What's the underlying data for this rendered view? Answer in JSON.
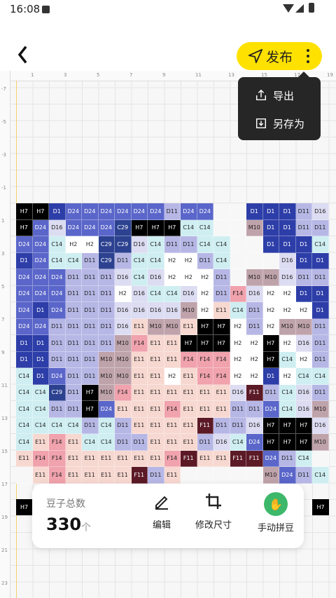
{
  "status": {
    "time": "16:08"
  },
  "header": {
    "publish_label": "发布"
  },
  "menu": {
    "export_label": "导出",
    "save_as_label": "另存为"
  },
  "panel": {
    "bean_total_label": "豆子总数",
    "bean_total_value": "330",
    "bean_total_unit": "个",
    "edit_label": "编辑",
    "resize_label": "修改尺寸",
    "manual_label": "手动拼豆"
  },
  "ruler": {
    "top": [
      "1",
      "3",
      "5",
      "7",
      "9",
      "11",
      "13",
      "15",
      "17",
      "19"
    ],
    "left": [
      "-7",
      "-5",
      "-3",
      "-1",
      "1",
      "3",
      "5",
      "7",
      "9",
      "11",
      "13",
      "15",
      "17",
      "19",
      "21",
      "23"
    ]
  },
  "colors": {
    "H7": "#000000",
    "D1": "#2d3ea8",
    "D24": "#5a66c9",
    "D11": "#b7b7e6",
    "D16": "#dcdcf2",
    "C14": "#cfeef1",
    "H2": "#ffffff",
    "C29": "#2c4290",
    "M10": "#bfa3ab",
    "E11": "#f7d8d0",
    "F14": "#f0a2ad",
    "F11": "#5b1a26",
    "D21": "#8e93d6",
    "": "#f7f7f7"
  },
  "side_cells": {
    "left": "H7",
    "right": "H7",
    "right_above": "D11",
    "right_above2": "11"
  },
  "grid": [
    [
      "H7",
      "H7",
      "D1",
      "D24",
      "D24",
      "D24",
      "D24",
      "D24",
      "D24",
      "D11",
      "D24",
      "D24",
      "",
      "",
      "D1",
      "D1",
      "D1",
      "D11",
      "D16"
    ],
    [
      "H7",
      "D24",
      "D16",
      "D24",
      "D24",
      "D24",
      "C29",
      "H7",
      "H7",
      "H7",
      "C14",
      "C14",
      "",
      "",
      "M10",
      "D1",
      "D1",
      "D11",
      "D11"
    ],
    [
      "D24",
      "D24",
      "C14",
      "H2",
      "H2",
      "C29",
      "C29",
      "D16",
      "C14",
      "D11",
      "D11",
      "C14",
      "C14",
      "",
      "",
      "D1",
      "D1",
      "D1",
      "C14"
    ],
    [
      "D1",
      "D24",
      "C14",
      "C14",
      "D11",
      "C29",
      "D11",
      "C14",
      "C14",
      "H2",
      "H2",
      "D11",
      "C14",
      "",
      "",
      "",
      "D16",
      "D1",
      "D1"
    ],
    [
      "D24",
      "D24",
      "D24",
      "D11",
      "D11",
      "D11",
      "D16",
      "C14",
      "D16",
      "H2",
      "H2",
      "H2",
      "D11",
      "",
      "M10",
      "M10",
      "D16",
      "D11",
      "D11"
    ],
    [
      "D24",
      "D24",
      "D24",
      "D11",
      "D11",
      "D11",
      "H2",
      "D16",
      "C14",
      "C14",
      "D16",
      "H2",
      "D11",
      "F14",
      "D16",
      "H2",
      "H2",
      "D1",
      "D1"
    ],
    [
      "D24",
      "D1",
      "D24",
      "D11",
      "D11",
      "D11",
      "D16",
      "D16",
      "D16",
      "D16",
      "M10",
      "H2",
      "E11",
      "C14",
      "D11",
      "H2",
      "H2",
      "H2",
      "D1"
    ],
    [
      "D24",
      "D24",
      "D11",
      "D11",
      "D11",
      "D11",
      "D16",
      "E11",
      "M10",
      "M10",
      "E11",
      "H7",
      "H7",
      "H2",
      "D11",
      "H2",
      "M10",
      "M10",
      "D11"
    ],
    [
      "D1",
      "D1",
      "D11",
      "D11",
      "D11",
      "D11",
      "M10",
      "F14",
      "E11",
      "E11",
      "H7",
      "H7",
      "H7",
      "H2",
      "H2",
      "H7",
      "H2",
      "D16",
      "D11"
    ],
    [
      "D1",
      "D1",
      "D11",
      "D11",
      "D11",
      "M10",
      "M10",
      "E11",
      "E11",
      "E11",
      "F14",
      "F14",
      "F14",
      "H2",
      "H2",
      "H7",
      "C14",
      "H2",
      "D11"
    ],
    [
      "C14",
      "D1",
      "D24",
      "D11",
      "D11",
      "M10",
      "M10",
      "E11",
      "E11",
      "H2",
      "E11",
      "F14",
      "F14",
      "H2",
      "H2",
      "D1",
      "H2",
      "C14",
      "C14"
    ],
    [
      "C14",
      "C14",
      "C29",
      "D11",
      "H7",
      "M10",
      "F14",
      "E11",
      "E11",
      "E11",
      "E11",
      "E11",
      "E11",
      "D16",
      "F11",
      "D11",
      "C14",
      "D16",
      "D11"
    ],
    [
      "C14",
      "C14",
      "D11",
      "D11",
      "H7",
      "D24",
      "E11",
      "E11",
      "E11",
      "F14",
      "E11",
      "E11",
      "E11",
      "D11",
      "D11",
      "D24",
      "C14",
      "D16",
      "M10"
    ],
    [
      "C14",
      "C14",
      "C14",
      "C14",
      "D11",
      "C14",
      "D11",
      "E11",
      "E11",
      "E11",
      "E11",
      "F11",
      "D11",
      "D11",
      "D16",
      "H7",
      "H7",
      "H7",
      "D16"
    ],
    [
      "C14",
      "E11",
      "F14",
      "E11",
      "C14",
      "C14",
      "D11",
      "D11",
      "E11",
      "E11",
      "E11",
      "D11",
      "D16",
      "C14",
      "D24",
      "H7",
      "H7",
      "H7",
      "M10"
    ],
    [
      "E11",
      "F14",
      "F14",
      "E11",
      "E11",
      "E11",
      "E11",
      "E11",
      "E11",
      "F14",
      "F11",
      "E11",
      "E11",
      "F11",
      "F11",
      "D24",
      "D11",
      "C14",
      ""
    ],
    [
      "",
      "E11",
      "F14",
      "E11",
      "E11",
      "E11",
      "E11",
      "F11",
      "D11",
      "E11",
      "",
      "",
      "",
      "",
      "",
      "M10",
      "D24",
      "D11",
      "C14"
    ]
  ]
}
